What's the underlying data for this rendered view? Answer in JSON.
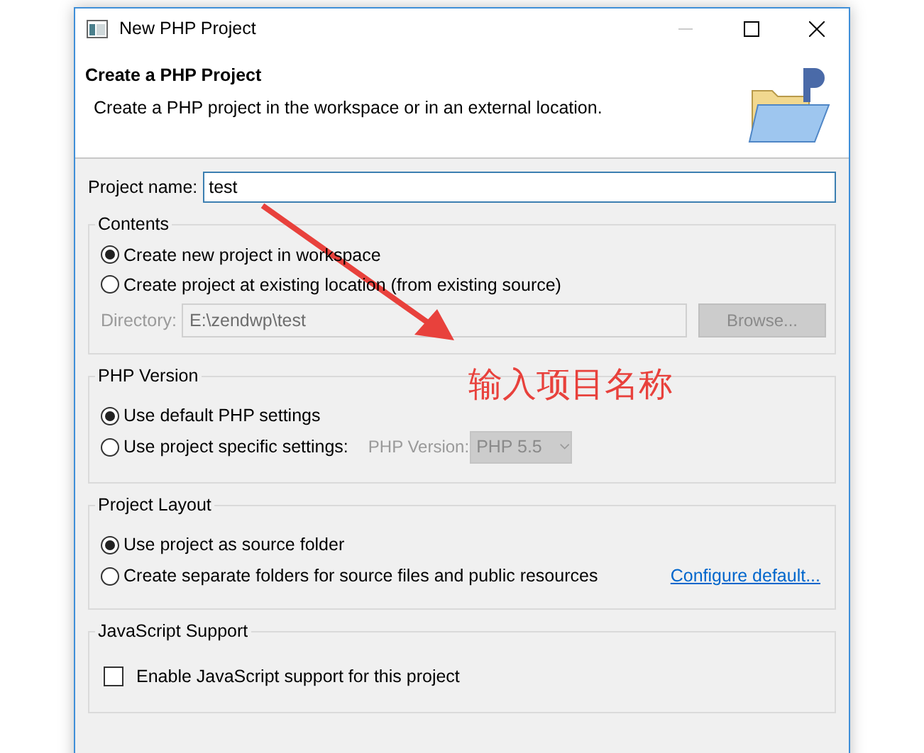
{
  "window": {
    "title": "New PHP Project"
  },
  "header": {
    "title": "Create a PHP Project",
    "description": "Create a PHP project in the workspace or in an external location."
  },
  "project_name": {
    "label": "Project name:",
    "value": "test"
  },
  "groups": [
    {
      "title": "Contents",
      "options": [
        {
          "kind": "radio",
          "label": "Create new project in workspace",
          "selected": true
        },
        {
          "kind": "radio",
          "label": "Create project at existing location (from existing source)",
          "selected": false
        },
        {
          "kind": "directory",
          "label": "Directory:",
          "value": "E:\\zendwp\\test",
          "disabled": true,
          "button": "Browse..."
        }
      ]
    },
    {
      "title": "PHP Version",
      "options": [
        {
          "kind": "radio",
          "label": "Use default PHP settings",
          "selected": true
        },
        {
          "kind": "radio",
          "label": "Use project specific settings:",
          "selected": false,
          "extra": {
            "label": "PHP Version:",
            "value": "PHP 5.5",
            "disabled": true
          }
        }
      ]
    },
    {
      "title": "Project Layout",
      "options": [
        {
          "kind": "radio",
          "label": "Use project as source folder",
          "selected": true
        },
        {
          "kind": "radio",
          "label": "Create separate folders for source files and public resources",
          "selected": false,
          "link": "Configure default..."
        }
      ]
    },
    {
      "title": "JavaScript Support",
      "options": [
        {
          "kind": "checkbox",
          "label": "Enable JavaScript support for this project",
          "checked": false
        }
      ]
    }
  ],
  "annotation": {
    "text": "输入项目名称",
    "color": "#e8413c"
  }
}
